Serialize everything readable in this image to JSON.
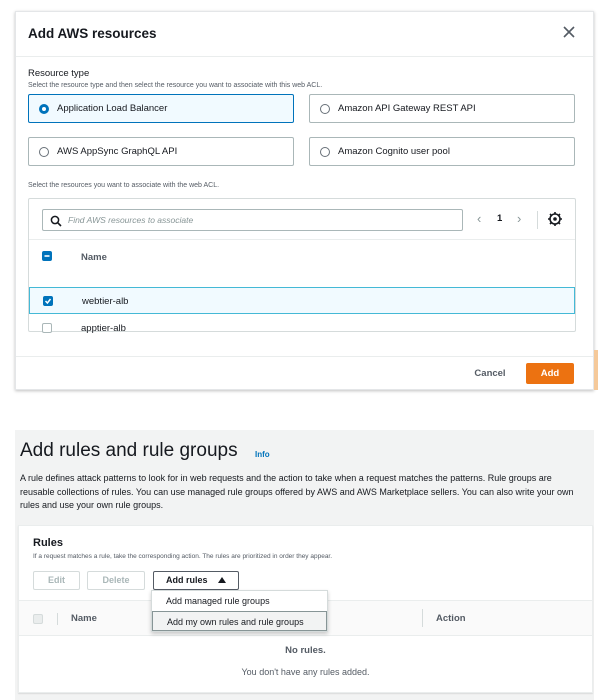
{
  "modal": {
    "title": "Add AWS resources",
    "resource_type_label": "Resource type",
    "resource_type_desc": "Select the resource type and then select the resource you want to associate with this web ACL.",
    "resource_types": [
      {
        "label": "Application Load Balancer",
        "selected": true
      },
      {
        "label": "Amazon API Gateway REST API",
        "selected": false
      },
      {
        "label": "AWS AppSync GraphQL API",
        "selected": false
      },
      {
        "label": "Amazon Cognito user pool",
        "selected": false
      }
    ],
    "resources_desc": "Select the resources you want to associate with the web ACL.",
    "search_placeholder": "Find AWS resources to associate",
    "page_number": "1",
    "column_name": "Name",
    "resources": [
      {
        "name": "webtier-alb",
        "checked": true
      },
      {
        "name": "apptier-alb",
        "checked": false
      }
    ],
    "cancel_label": "Cancel",
    "add_label": "Add"
  },
  "rules_section": {
    "heading": "Add rules and rule groups",
    "info_link": "Info",
    "description": "A rule defines attack patterns to look for in web requests and the action to take when a request matches the patterns. Rule groups are reusable collections of rules. You can use managed rule groups offered by AWS and AWS Marketplace sellers. You can also write your own rules and use your own rule groups.",
    "panel_title": "Rules",
    "panel_subtitle": "If a request matches a rule, take the corresponding action. The rules are prioritized in order they appear.",
    "edit_label": "Edit",
    "delete_label": "Delete",
    "add_rules_label": "Add rules",
    "col_name": "Name",
    "col_action": "Action",
    "empty_title": "No rules.",
    "empty_subtitle": "You don't have any rules added.",
    "dropdown_items": [
      {
        "label": "Add managed rule groups",
        "hovered": false
      },
      {
        "label": "Add my own rules and rule groups",
        "hovered": true
      }
    ]
  },
  "colors": {
    "accent_blue": "#0073bb",
    "primary_orange": "#ec7211",
    "selected_bg": "#f1faff"
  }
}
